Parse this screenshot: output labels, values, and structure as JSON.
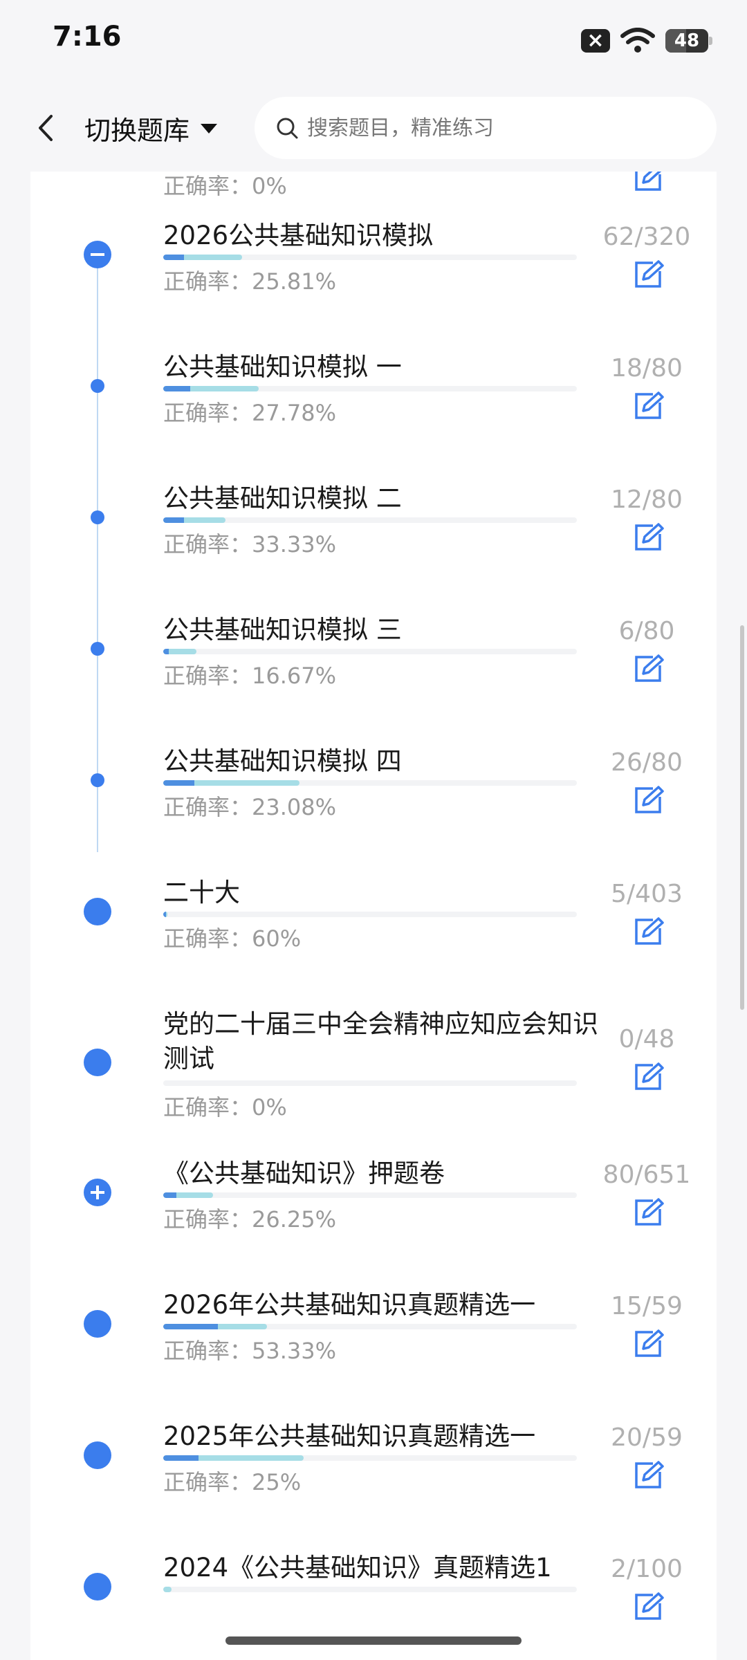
{
  "status_bar": {
    "time": "7:16",
    "battery": "48"
  },
  "nav": {
    "title": "切换题库",
    "search_placeholder": "搜索题目，精准练习"
  },
  "partial_top": {
    "accuracy": "正确率：0%"
  },
  "items": [
    {
      "title": "2026公共基础知识模拟",
      "count": "62/320",
      "accuracy": "正确率：25.81%",
      "progress": 0.19,
      "correct_rate": 0.26,
      "marker": "minus"
    },
    {
      "title": "公共基础知识模拟 一",
      "count": "18/80",
      "accuracy": "正确率：27.78%",
      "progress": 0.23,
      "correct_rate": 0.28,
      "marker": "small"
    },
    {
      "title": "公共基础知识模拟 二",
      "count": "12/80",
      "accuracy": "正确率：33.33%",
      "progress": 0.15,
      "correct_rate": 0.33,
      "marker": "small"
    },
    {
      "title": "公共基础知识模拟 三",
      "count": "6/80",
      "accuracy": "正确率：16.67%",
      "progress": 0.08,
      "correct_rate": 0.17,
      "marker": "small"
    },
    {
      "title": "公共基础知识模拟 四",
      "count": "26/80",
      "accuracy": "正确率：23.08%",
      "progress": 0.33,
      "correct_rate": 0.23,
      "marker": "small"
    },
    {
      "title": "二十大",
      "count": "5/403",
      "accuracy": "正确率：60%",
      "progress": 0.01,
      "correct_rate": 0.6,
      "marker": "big"
    },
    {
      "title": "党的二十届三中全会精神应知应会知识测试",
      "count": "0/48",
      "accuracy": "正确率：0%",
      "progress": 0.0,
      "correct_rate": 0.0,
      "marker": "big"
    },
    {
      "title": "《公共基础知识》押题卷",
      "count": "80/651",
      "accuracy": "正确率：26.25%",
      "progress": 0.12,
      "correct_rate": 0.26,
      "marker": "plus"
    },
    {
      "title": "2026年公共基础知识真题精选一",
      "count": "15/59",
      "accuracy": "正确率：53.33%",
      "progress": 0.25,
      "correct_rate": 0.53,
      "marker": "big"
    },
    {
      "title": "2025年公共基础知识真题精选一",
      "count": "20/59",
      "accuracy": "正确率：25%",
      "progress": 0.34,
      "correct_rate": 0.25,
      "marker": "big"
    },
    {
      "title": "2024《公共基础知识》真题精选1",
      "count": "2/100",
      "accuracy": "",
      "progress": 0.02,
      "correct_rate": 0.0,
      "marker": "big"
    }
  ],
  "colors": {
    "accent": "#3b7ded",
    "bar_light": "#a6dde6",
    "bar_dark": "#4e8fe0"
  },
  "icons": {
    "back": "chevron-left-icon",
    "search": "search-icon",
    "edit": "edit-icon",
    "dropdown": "caret-down-icon"
  }
}
